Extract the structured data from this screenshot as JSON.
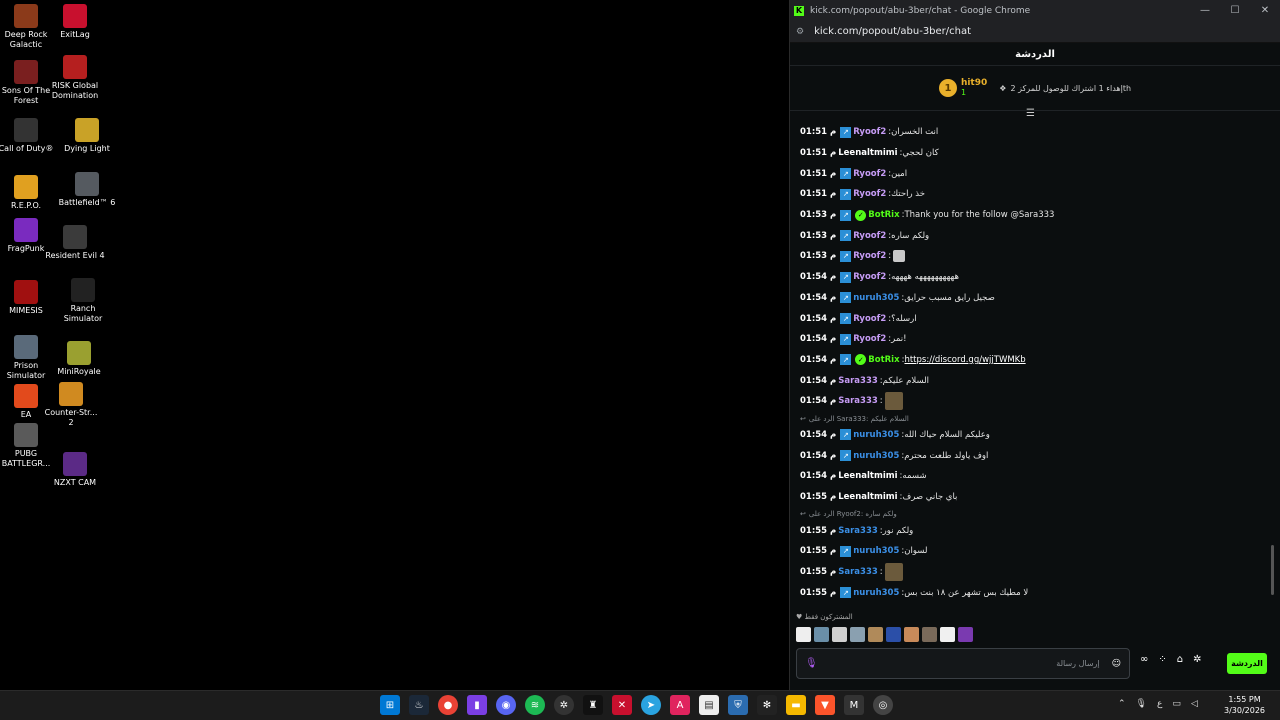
{
  "desktop": {
    "icons": [
      {
        "label": "Deep Rock Galactic",
        "color": "#8b3a1a"
      },
      {
        "label": "ExitLag",
        "color": "#c8102e"
      },
      {
        "label": "Sons Of The Forest",
        "color": "#7a1f1f"
      },
      {
        "label": "RISK Global Domination",
        "color": "#b51f1f"
      },
      {
        "label": "Call of Duty®",
        "color": "#333333"
      },
      {
        "label": "Dying Light",
        "color": "#c9a227"
      },
      {
        "label": "R.E.P.O.",
        "color": "#e0a020"
      },
      {
        "label": "Battlefield™ 6",
        "color": "#555a60"
      },
      {
        "label": "FragPunk",
        "color": "#7a2bbf"
      },
      {
        "label": "Resident Evil 4",
        "color": "#3b3b3b"
      },
      {
        "label": "MIMESIS",
        "color": "#a01010"
      },
      {
        "label": "Ranch Simulator",
        "color": "#222222"
      },
      {
        "label": "Prison Simulator",
        "color": "#5a6a7a"
      },
      {
        "label": "MiniRoyale",
        "color": "#9aa030"
      },
      {
        "label": "EA",
        "color": "#e24a1c"
      },
      {
        "label": "Counter-Str... 2",
        "color": "#d08a20"
      },
      {
        "label": "PUBG BATTLEGR...",
        "color": "#5a5a5a"
      },
      {
        "label": "NZXT CAM",
        "color": "#5b2a86"
      }
    ]
  },
  "window": {
    "title": "kick.com/popout/abu-3ber/chat - Google Chrome",
    "url": "kick.com/popout/abu-3ber/chat",
    "minimize": "—",
    "maximize": "☐",
    "close": "✕"
  },
  "chat": {
    "header": "الدردشة",
    "leaderboard": {
      "rank": "1",
      "user": "hit90",
      "count": "1",
      "subtext": "إهداء 1 اشتراك للوصول للمركز 2",
      "suffix": "th"
    },
    "messages": [
      {
        "ts": "01:51 م",
        "user": "Ryoof2",
        "color": "#c69cf5",
        "text": "انت الخسران",
        "badge": "sub"
      },
      {
        "ts": "01:51 م",
        "user": "Leenaltmimi",
        "color": "#ffffff",
        "text": "كان لحجي",
        "badge": ""
      },
      {
        "ts": "01:51 م",
        "user": "Ryoof2",
        "color": "#c69cf5",
        "text": "امين",
        "badge": "sub"
      },
      {
        "ts": "01:51 م",
        "user": "Ryoof2",
        "color": "#c69cf5",
        "text": "خذ راحتك",
        "badge": "sub"
      },
      {
        "ts": "01:53 م",
        "user": "BotRix",
        "color": "#53fc18",
        "text": "Thank you for the follow @Sara333",
        "badge": "bot"
      },
      {
        "ts": "01:53 م",
        "user": "Ryoof2",
        "color": "#c69cf5",
        "text": "ولكم ساره",
        "badge": "sub"
      },
      {
        "ts": "01:53 م",
        "user": "Ryoof2",
        "color": "#c69cf5",
        "text": "",
        "emote": "small",
        "badge": "sub"
      },
      {
        "ts": "01:54 م",
        "user": "Ryoof2",
        "color": "#c69cf5",
        "text": "ههههههههههه ههههه",
        "badge": "sub"
      },
      {
        "ts": "01:54 م",
        "user": "nuruh305",
        "color": "#3b8fe6",
        "text": "صجيل رايق مسبب حرايق",
        "badge": "sub"
      },
      {
        "ts": "01:54 م",
        "user": "Ryoof2",
        "color": "#c69cf5",
        "text": "ارسله؟",
        "badge": "sub"
      },
      {
        "ts": "01:54 م",
        "user": "Ryoof2",
        "color": "#c69cf5",
        "text": "نمر!",
        "badge": "sub"
      },
      {
        "ts": "01:54 م",
        "user": "BotRix",
        "color": "#53fc18",
        "text": "https://discord.gg/wjjTWMKb",
        "link": true,
        "badge": "bot"
      },
      {
        "ts": "01:54 م",
        "user": "Sara333",
        "color": "#c69cf5",
        "text": "السلام عليكم",
        "badge": ""
      },
      {
        "ts": "01:54 م",
        "user": "Sara333",
        "color": "#c69cf5",
        "text": "",
        "emote": "large",
        "badge": ""
      },
      {
        "reply": "الرد على Sara333: السلام عليكم"
      },
      {
        "ts": "01:54 م",
        "user": "nuruh305",
        "color": "#3b8fe6",
        "text": "وعليكم السلام حياك الله",
        "badge": "sub"
      },
      {
        "ts": "01:54 م",
        "user": "nuruh305",
        "color": "#3b8fe6",
        "text": "اوف ياولد طلعت محترم",
        "badge": "sub"
      },
      {
        "ts": "01:54 م",
        "user": "Leenaltmimi",
        "color": "#ffffff",
        "text": "شسمه",
        "badge": ""
      },
      {
        "ts": "01:55 م",
        "user": "Leenaltmimi",
        "color": "#ffffff",
        "text": "باي جاني صرف",
        "badge": ""
      },
      {
        "reply": "الرد على Ryoof2: ولكم ساره"
      },
      {
        "ts": "01:55 م",
        "user": "Sara333",
        "color": "#3b8fe6",
        "text": "ولكم نور",
        "badge": ""
      },
      {
        "ts": "01:55 م",
        "user": "nuruh305",
        "color": "#3b8fe6",
        "text": "لسوان",
        "badge": "sub"
      },
      {
        "ts": "01:55 م",
        "user": "Sara333",
        "color": "#3b8fe6",
        "text": "",
        "emote": "large",
        "badge": ""
      },
      {
        "ts": "01:55 م",
        "user": "nuruh305",
        "color": "#3b8fe6",
        "text": "لا مطيك بس تشهر عن ١٨ بنت بس",
        "badge": "sub"
      }
    ],
    "subs_only": "المشتركون فقط",
    "input_placeholder": "إرسال رسالة",
    "send_label": "الدردشة"
  },
  "taskbar": {
    "time": "1:55 PM",
    "date": "3/30/2026",
    "lang": "ع"
  }
}
